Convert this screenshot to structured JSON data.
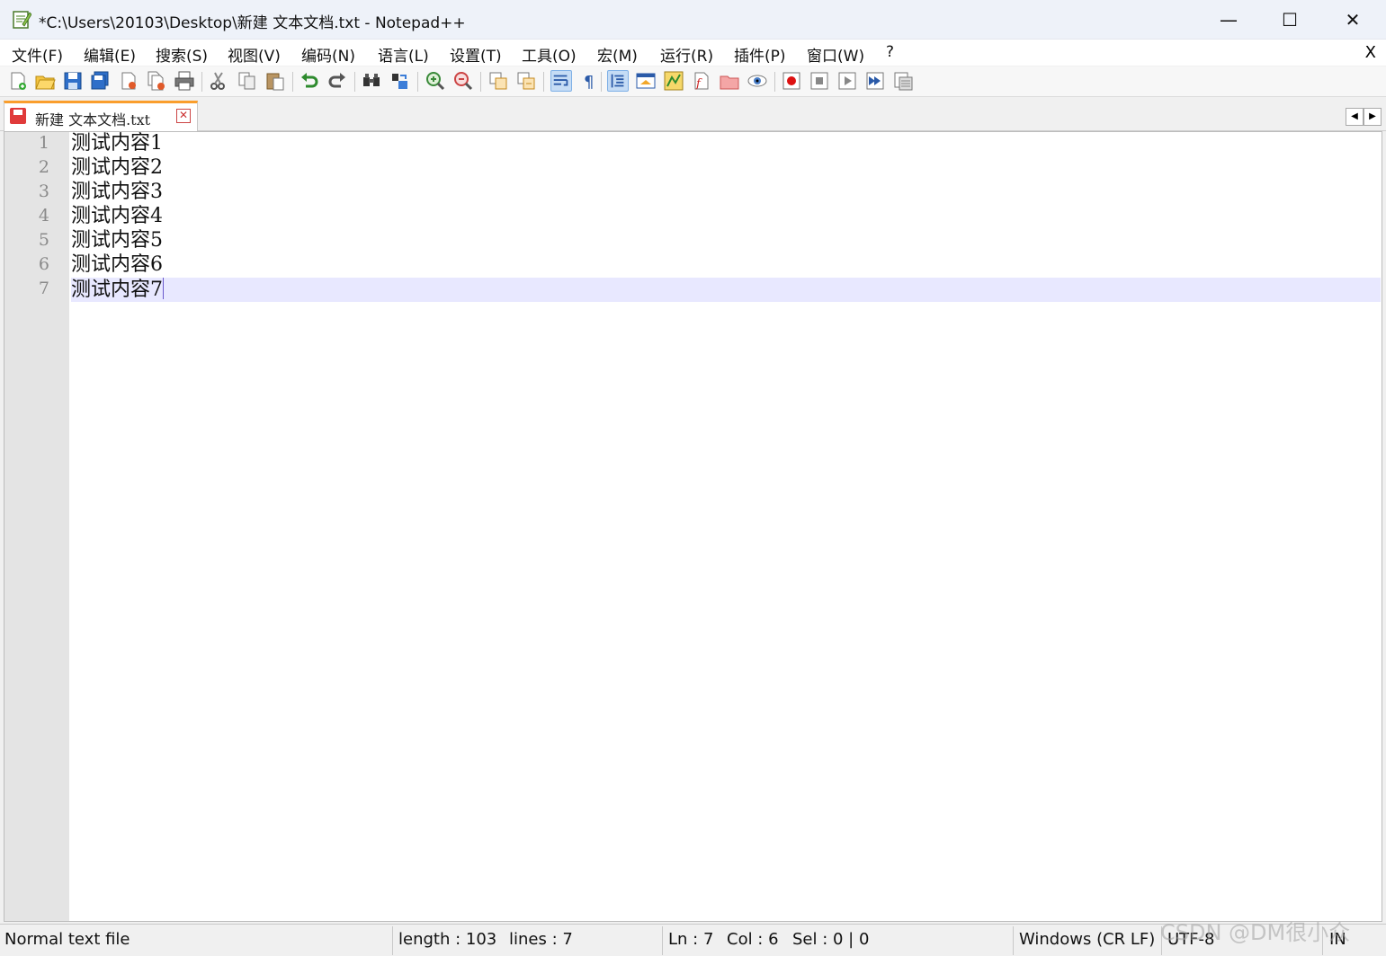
{
  "window": {
    "title": "*C:\\Users\\20103\\Desktop\\新建 文本文档.txt - Notepad++",
    "min_glyph": "—",
    "max_glyph": "☐",
    "close_glyph": "✕"
  },
  "menu": {
    "items": [
      "文件(F)",
      "编辑(E)",
      "搜索(S)",
      "视图(V)",
      "编码(N)",
      "语言(L)",
      "设置(T)",
      "工具(O)",
      "宏(M)",
      "运行(R)",
      "插件(P)",
      "窗口(W)",
      "?"
    ],
    "close_label": "X"
  },
  "toolbar": {
    "icons": [
      "new-file-icon",
      "open-file-icon",
      "save-icon",
      "save-all-icon",
      "close-icon",
      "close-all-icon",
      "print-icon",
      "cut-icon",
      "copy-icon",
      "paste-icon",
      "undo-icon",
      "redo-icon",
      "find-icon",
      "replace-icon",
      "zoom-in-icon",
      "zoom-out-icon",
      "sync-vertical-icon",
      "sync-horizontal-icon",
      "word-wrap-icon",
      "show-all-chars-icon",
      "indent-guide-icon",
      "define-language-icon",
      "doc-map-icon",
      "function-list-icon",
      "folder-workspace-icon",
      "monitoring-icon",
      "record-macro-icon",
      "stop-record-icon",
      "play-macro-icon",
      "run-macro-multiple-icon",
      "save-macro-icon"
    ]
  },
  "tab": {
    "label": "新建 文本文档.txt",
    "close_glyph": "✕",
    "scroll_left": "◀",
    "scroll_right": "▶"
  },
  "editor": {
    "lines": [
      "测试内容1",
      "测试内容2",
      "测试内容3",
      "测试内容4",
      "测试内容5",
      "测试内容6",
      "测试内容7"
    ],
    "line_numbers": [
      "1",
      "2",
      "3",
      "4",
      "5",
      "6",
      "7"
    ],
    "current_line": 7
  },
  "status": {
    "file_type": "Normal text file",
    "length": "length : 103",
    "lines": "lines : 7",
    "ln": "Ln : 7",
    "col": "Col : 6",
    "sel": "Sel : 0 | 0",
    "eol": "Windows (CR LF)",
    "encoding": "UTF-8",
    "mode": "IN"
  },
  "watermark": "CSDN @DM很小众",
  "colors": {
    "tab_accent": "#fa9e2c",
    "current_line_bg": "#e8e8ff",
    "gutter_bg": "#e4e4e4"
  }
}
